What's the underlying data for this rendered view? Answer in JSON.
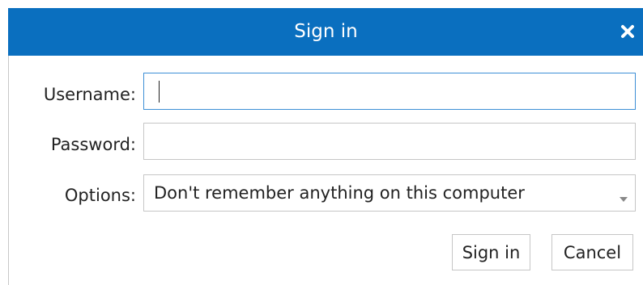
{
  "dialog": {
    "title": "Sign in",
    "close_icon": "close-icon"
  },
  "form": {
    "username": {
      "label": "Username:",
      "value": "",
      "placeholder": ""
    },
    "password": {
      "label": "Password:",
      "value": "",
      "placeholder": ""
    },
    "options": {
      "label": "Options:",
      "selected": "Don't remember anything on this computer",
      "arrow_icon": "dropdown-arrow-icon"
    }
  },
  "actions": {
    "signin_label": "Sign in",
    "cancel_label": "Cancel"
  },
  "colors": {
    "titlebar": "#0a6fbf",
    "focus_border": "#3d8fd6",
    "field_border": "#c6c6c6"
  }
}
